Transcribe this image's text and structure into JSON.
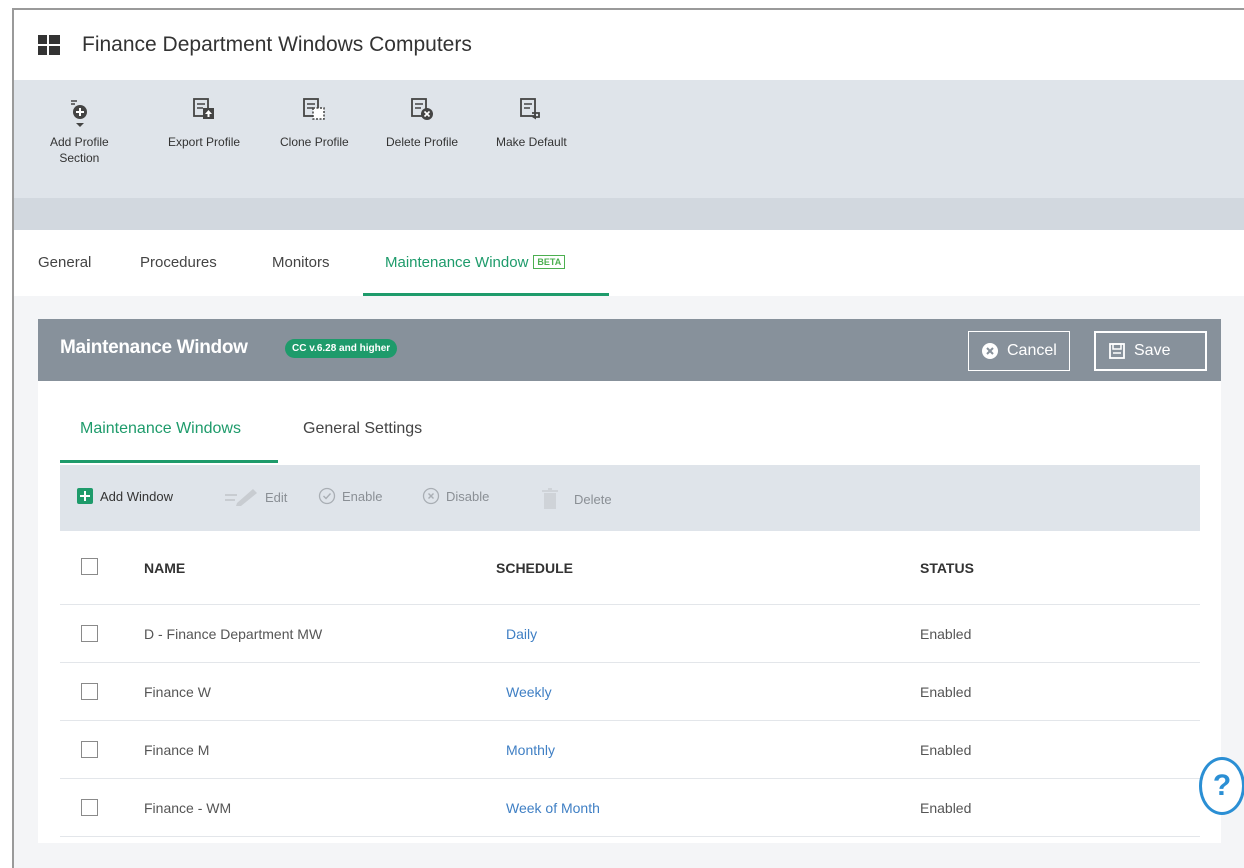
{
  "title": "Finance Department Windows Computers",
  "toolbar": {
    "buttons": [
      {
        "label_line1": "Add Profile",
        "label_line2": "Section"
      },
      {
        "label": "Export Profile"
      },
      {
        "label": "Clone Profile"
      },
      {
        "label": "Delete Profile"
      },
      {
        "label": "Make Default"
      }
    ]
  },
  "tabs": {
    "general": "General",
    "procedures": "Procedures",
    "monitors": "Monitors",
    "maintenance": "Maintenance Window",
    "beta": "BETA",
    "active": "Maintenance Window"
  },
  "panel": {
    "title": "Maintenance Window",
    "badge": "CC v.6.28 and higher",
    "cancel": "Cancel",
    "save": "Save"
  },
  "subtabs": {
    "windows": "Maintenance Windows",
    "settings": "General Settings",
    "active": "Maintenance Windows"
  },
  "actions": {
    "add": "Add Window",
    "edit": "Edit",
    "enable": "Enable",
    "disable": "Disable",
    "delete": "Delete"
  },
  "table": {
    "headers": {
      "name": "NAME",
      "schedule": "SCHEDULE",
      "status": "STATUS"
    },
    "rows": [
      {
        "name": "D - Finance Department MW",
        "schedule": "Daily",
        "status": "Enabled"
      },
      {
        "name": "Finance W",
        "schedule": "Weekly",
        "status": "Enabled"
      },
      {
        "name": "Finance M",
        "schedule": "Monthly",
        "status": "Enabled"
      },
      {
        "name": "Finance - WM",
        "schedule": "Week of Month",
        "status": "Enabled"
      }
    ]
  },
  "help": "?",
  "colors": {
    "accent": "#1e9b6b",
    "link": "#3f7fc4",
    "header_bg": "#87919b"
  },
  "icons": [
    "windows-logo-icon",
    "add-section-icon",
    "export-icon",
    "clone-icon",
    "delete-profile-icon",
    "make-default-icon",
    "cancel-icon",
    "save-icon",
    "plus-icon",
    "edit-icon",
    "enable-icon",
    "disable-icon",
    "trash-icon",
    "help-icon"
  ]
}
